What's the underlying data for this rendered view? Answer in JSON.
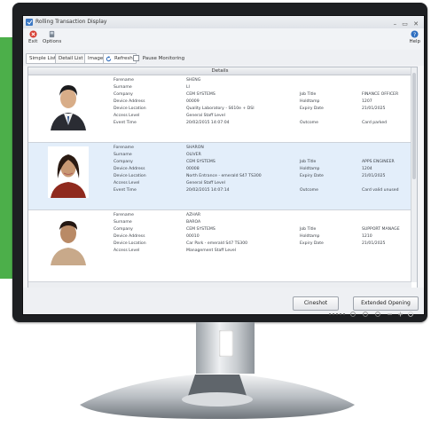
{
  "window": {
    "title": "Rolling Transaction Display",
    "controls": "– ▭ ✕"
  },
  "toolbar": {
    "exit_label": "Exit",
    "options_label": "Options",
    "help_label": "Help"
  },
  "tabs": [
    {
      "label": "Simple List"
    },
    {
      "label": "Detail List"
    },
    {
      "label": "Image"
    },
    {
      "label": "Refresh"
    },
    {
      "label": "Pause Monitoring"
    }
  ],
  "table": {
    "header": "Details"
  },
  "records": [
    {
      "rows": [
        [
          "Forename",
          "SHENG",
          "",
          ""
        ],
        [
          "Surname",
          "LI",
          "",
          ""
        ],
        [
          "Company",
          "CEM SYSTEMS",
          "Job Title",
          "FINANCE OFFICER"
        ],
        [
          "Device Address",
          "00009",
          "Holdtamp",
          "1207"
        ],
        [
          "Device Location",
          "Quality Laboratory - S610e + DSI",
          "Expiry Date",
          "21/01/2025"
        ],
        [
          "Access Level",
          "General Staff Level",
          "",
          ""
        ],
        [
          "Event Time",
          "20/02/2015 14:07:04",
          "Outcome",
          "Card parked"
        ]
      ]
    },
    {
      "rows": [
        [
          "Forename",
          "SHARON",
          "",
          ""
        ],
        [
          "Surname",
          "OLIVER",
          "",
          ""
        ],
        [
          "Company",
          "CEM SYSTEMS",
          "Job Title",
          "APPS ENGINEER"
        ],
        [
          "Device Address",
          "00008",
          "Holdtamp",
          "1204"
        ],
        [
          "Device Location",
          "North Entrance - emerald S47 TS300",
          "Expiry Date",
          "21/01/2025"
        ],
        [
          "Access Level",
          "General Staff Level",
          "",
          ""
        ],
        [
          "Event Time",
          "20/02/2015 14:07:14",
          "Outcome",
          "Card valid unused"
        ]
      ]
    },
    {
      "rows": [
        [
          "Forename",
          "AZHAR",
          "",
          ""
        ],
        [
          "Surname",
          "BAROA",
          "",
          ""
        ],
        [
          "Company",
          "CEM SYSTEMS",
          "Job Title",
          "SUPPORT MANAGE"
        ],
        [
          "Device Address",
          "00010",
          "Holdtamp",
          "1210"
        ],
        [
          "Device Location",
          "Car Park - emerald S47 TS300",
          "Expiry Date",
          "21/01/2025"
        ],
        [
          "Access Level",
          "Management Staff Level",
          "",
          ""
        ]
      ]
    }
  ],
  "buttons": {
    "cineshot": "Cineshot",
    "extended_opening": "Extended Opening"
  },
  "colors": {
    "accent_green": "#4caf4a",
    "selection": "#e3eefa"
  }
}
